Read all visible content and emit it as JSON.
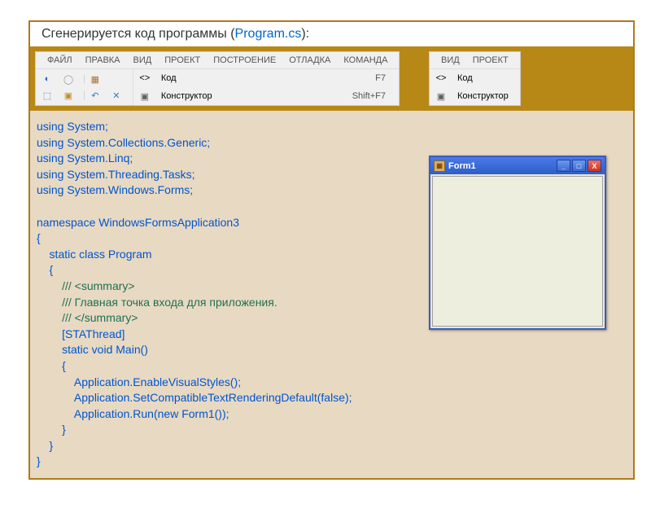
{
  "title": {
    "text": "Сгенерируется код программы (",
    "filename": "Program.cs",
    "close": "):"
  },
  "leftMenu": {
    "tabs": [
      "ФАЙЛ",
      "ПРАВКА",
      "ВИД",
      "ПРОЕКТ",
      "ПОСТРОЕНИЕ",
      "ОТЛАДКА",
      "КОМАНДА"
    ],
    "rows": [
      {
        "icon": "<>",
        "label": "Код",
        "shortcut": "F7"
      },
      {
        "icon": "▣",
        "label": "Конструктор",
        "shortcut": "Shift+F7"
      }
    ]
  },
  "rightMenu": {
    "tabs": [
      "ВИД",
      "ПРОЕКТ"
    ],
    "rows": [
      {
        "icon": "<>",
        "label": "Код"
      },
      {
        "icon": "▣",
        "label": "Конструктор"
      }
    ]
  },
  "code": {
    "l1": "using System;",
    "l2": "using System.Collections.Generic;",
    "l3": "using System.Linq;",
    "l4": "using System.Threading.Tasks;",
    "l5": "using System.Windows.Forms;",
    "l6": "",
    "l7": "namespace WindowsFormsApplication3",
    "l8": "{",
    "l9": "    static class Program",
    "l10": "    {",
    "l11": "        /// <summary>",
    "l12": "        /// Главная точка входа для приложения.",
    "l13": "        /// </summary>",
    "l14": "        [STAThread]",
    "l15": "        static void Main()",
    "l16": "        {",
    "l17": "            Application.EnableVisualStyles();",
    "l18": "            Application.SetCompatibleTextRenderingDefault(false);",
    "l19": "            Application.Run(new Form1());",
    "l20": "        }",
    "l21": "    }",
    "l22": "}"
  },
  "form": {
    "title": "Form1",
    "min": "_",
    "max": "□",
    "close": "X"
  }
}
